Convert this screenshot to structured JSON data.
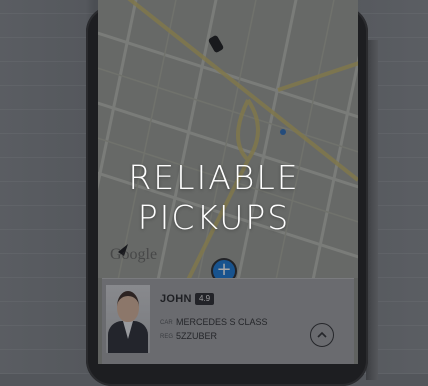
{
  "hero": {
    "line1": "RELIABLE",
    "line2": "PICKUPS"
  },
  "map": {
    "watermark": "Google",
    "add_button_glyph": "+"
  },
  "driver": {
    "name": "JOHN",
    "rating": "4.9",
    "car_label": "CAR",
    "car": "MERCEDES S CLASS",
    "plate_label": "REG",
    "plate": "5ZZUBER"
  },
  "icons": {
    "vehicle": "car-icon",
    "location": "location-arrow-icon",
    "add": "plus-icon",
    "expand": "chevron-up-icon"
  },
  "colors": {
    "accent": "#1a7ad6",
    "text_overlay": "#ffffff"
  }
}
